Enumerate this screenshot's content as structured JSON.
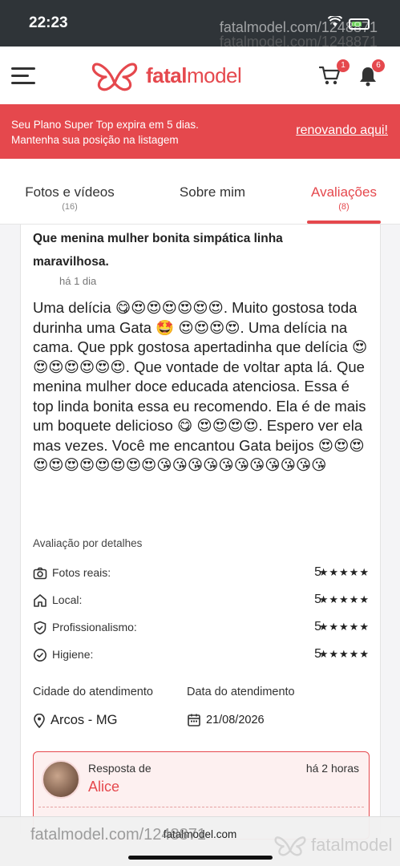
{
  "status_bar": {
    "time": "22:23"
  },
  "watermark": {
    "text1": "fatalmodel.com/1248871",
    "text2": "fatalmodel.com/1248871",
    "bottom": "fatalmodel.com/1248871",
    "bottom_logo": "fatalmodel"
  },
  "header": {
    "logo_bold": "fatal",
    "logo_light": "model",
    "cart_badge": "1",
    "bell_badge": "6"
  },
  "promo": {
    "line1": "Seu Plano Super Top expira em 5 dias.",
    "line2": "Mantenha sua posição na listagem",
    "link": "renovando aqui!"
  },
  "tabs": [
    {
      "label": "Fotos e vídeos",
      "count": "(16)"
    },
    {
      "label": "Sobre mim",
      "count": ""
    },
    {
      "label": "Avaliações",
      "count": "(8)"
    }
  ],
  "review": {
    "title": "Que menina mulher bonita simpática linha maravilhosa.",
    "time": "há 1 dia",
    "body": "Uma delícia 😋😍😍😍😍😍😍. Muito gostosa toda durinha uma Gata 🤩 😍😍😍😍. Uma delícia na cama. Que ppk gostosa apertadinha que delícia 😍😍😍😍😍😍😍. Que vontade de voltar apta lá. Que menina mulher doce educada atenciosa. Essa é top linda bonita essa eu recomendo. Ela é de mais um boquete delicioso 😋 😍😍😍😍. Espero ver ela mas vezes. Você me encantou Gata beijos 😍😍😍😍😍😍😍😍😍😍😍😘😘😘😘😘😘😘😘😘😘😘",
    "details_heading": "Avaliação por detalhes",
    "ratings": [
      {
        "label": "Fotos reais:",
        "value": "5",
        "stars": "★★★★★"
      },
      {
        "label": "Local:",
        "value": "5",
        "stars": "★★★★★"
      },
      {
        "label": "Profissionalismo:",
        "value": "5",
        "stars": "★★★★★"
      },
      {
        "label": "Higiene:",
        "value": "5",
        "stars": "★★★★★"
      }
    ],
    "city_label": "Cidade do atendimento",
    "city_value": "Arcos - MG",
    "date_label": "Data do atendimento",
    "date_value": "21/08/2026"
  },
  "reply": {
    "label": "Resposta de",
    "name": "Alice",
    "time": "há 2 horas"
  },
  "browser": {
    "url": "fatalmodel.com"
  },
  "colors": {
    "brand": "#e5484d",
    "status_bar": "#2f3438"
  }
}
